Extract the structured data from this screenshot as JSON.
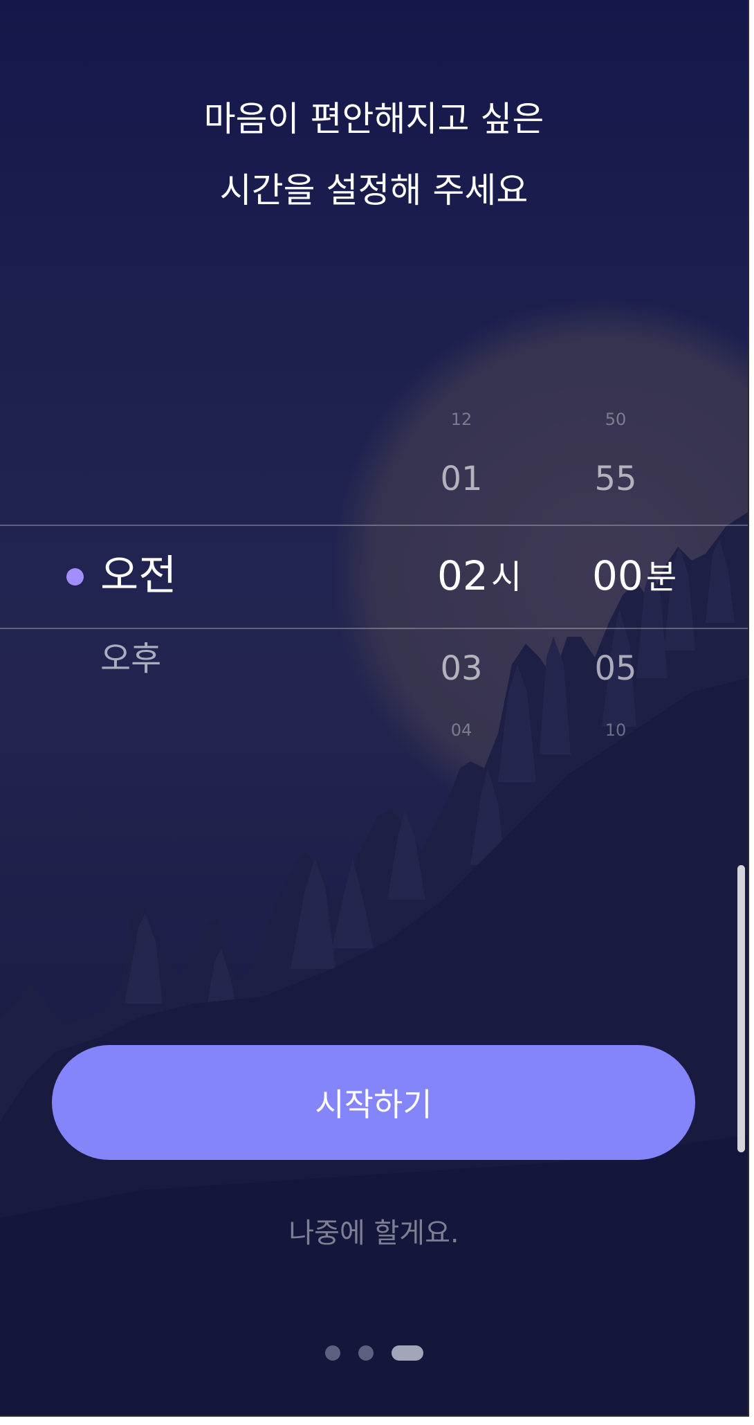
{
  "header": {
    "title_line1": "마음이 편안해지고 싶은",
    "title_line2": "시간을 설정해 주세요"
  },
  "time_picker": {
    "period_options": [
      "오전",
      "오후"
    ],
    "selected_period": "오전",
    "hours": {
      "far_above": "12",
      "above": "01",
      "selected": "02",
      "below": "03",
      "far_below": "04",
      "unit": "시"
    },
    "minutes": {
      "far_above": "50",
      "above": "55",
      "selected": "00",
      "below": "05",
      "far_below": "10",
      "unit": "분"
    }
  },
  "actions": {
    "start_label": "시작하기",
    "later_label": "나중에 할게요."
  },
  "pager": {
    "total": 3,
    "current": 3
  },
  "colors": {
    "background": "#1e2250",
    "accent_button": "#8484fb",
    "selected_dot": "#a38dff",
    "moon": "#3a3650"
  }
}
